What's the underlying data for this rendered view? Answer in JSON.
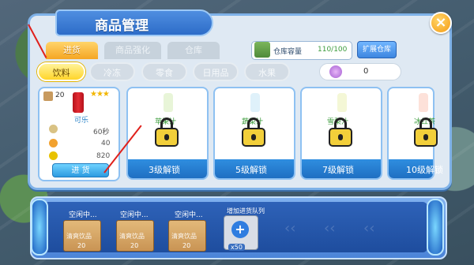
{
  "title": "商品管理",
  "close_icon": "×",
  "tabs": [
    {
      "label": "进货",
      "active": true
    },
    {
      "label": "商品强化",
      "active": false
    },
    {
      "label": "仓库",
      "active": false
    }
  ],
  "storage": {
    "label": "仓库容量",
    "value": "110/100",
    "expand_label": "扩展仓库"
  },
  "categories": [
    {
      "label": "饮料",
      "active": true
    },
    {
      "label": "冷冻",
      "active": false
    },
    {
      "label": "零食",
      "active": false
    },
    {
      "label": "日用品",
      "active": false
    },
    {
      "label": "水果",
      "active": false
    }
  ],
  "currency": {
    "value": "0"
  },
  "selected_product": {
    "level": "20",
    "stars": "★★★",
    "name": "可乐",
    "time": "60秒",
    "stat2": "40",
    "stat3": "820",
    "restock_label": "进 货"
  },
  "locked_products": [
    {
      "name": "苹果汁",
      "unlock": "3级解锁"
    },
    {
      "name": "蔬菜汁",
      "unlock": "5级解锁"
    },
    {
      "name": "雪梨汁",
      "unlock": "7级解锁"
    },
    {
      "name": "冰红茶",
      "unlock": "10级解锁"
    }
  ],
  "queue": {
    "slots": [
      {
        "status": "空闲中...",
        "label": "清爽饮品",
        "count": "20"
      },
      {
        "status": "空闲中...",
        "label": "清爽饮品",
        "count": "20"
      },
      {
        "status": "空闲中...",
        "label": "清爽饮品",
        "count": "20"
      }
    ],
    "add_label": "增加进货队列",
    "add_cost": "x50"
  },
  "colors": {
    "accent": "#2f7de0",
    "tab_active": "#f5a623",
    "pill_active": "#ffd52a",
    "annotation": "#e0211c"
  }
}
